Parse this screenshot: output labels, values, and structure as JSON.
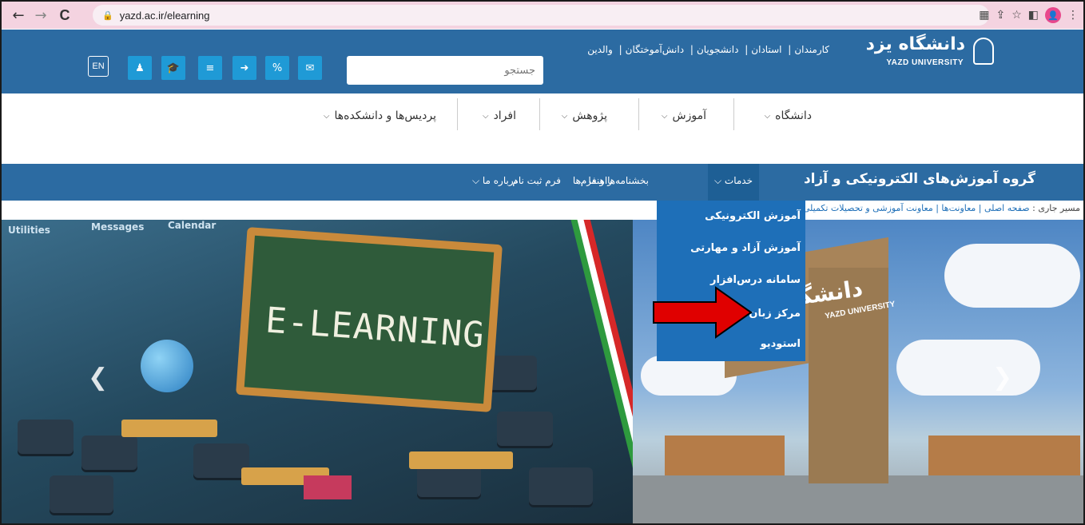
{
  "browser": {
    "url": "yazd.ac.ir/elearning",
    "back_icon": "←",
    "forward_icon": "→",
    "reload_icon": "C",
    "profile_initial": "●"
  },
  "header": {
    "logo_fa": "دانشگاه یزد",
    "logo_en": "YAZD UNIVERSITY",
    "top_links": [
      "کارمندان",
      "استادان",
      "دانشجویان",
      "دانش‌آموختگان",
      "والدین"
    ],
    "search_placeholder": "جستجو",
    "lang_button": "EN",
    "tool_icons": [
      "user-icon",
      "graduation-cap-icon",
      "database-icon",
      "sign-in-icon",
      "link-icon",
      "envelope-icon"
    ]
  },
  "main_nav": {
    "items": [
      {
        "label": "دانشگاه"
      },
      {
        "label": "آموزش"
      },
      {
        "label": "پژوهش"
      },
      {
        "label": "افراد"
      },
      {
        "label": "پردیس‌ها و دانشکده‌ها"
      }
    ]
  },
  "sub_nav": {
    "title": "گروه آموزش‌های الکترونیکی و آزاد",
    "items": [
      {
        "label": "خدمات"
      },
      {
        "label": "بخشنامه‌ها و فرم‌ها"
      },
      {
        "label": "راهنما"
      },
      {
        "label": "فرم ثبت نام"
      },
      {
        "label": "درباره ما"
      }
    ]
  },
  "breadcrumb": {
    "label": "مسیر جاری :",
    "path": "صفحه اصلی | معاونت‌ها | معاونت آموزشی و تحصیلات تکمیلی | گروه آموزش‌های الکترونیکی و آزاد"
  },
  "dropdown": {
    "items": [
      {
        "label": "آموزش الکترونیکی"
      },
      {
        "label": "آموزش آزاد و مهارتی"
      },
      {
        "label": "سامانه درس‌افزار"
      },
      {
        "label": "مرکز زبان"
      },
      {
        "label": "استودیو"
      }
    ]
  },
  "hero": {
    "board_text": "E-LEARNING",
    "gate_text_fa": "دانشگاه یزد",
    "gate_text_en": "YAZD UNIVERSITY",
    "app_labels": [
      "Utilities",
      "Messages",
      "Calendar"
    ]
  },
  "colors": {
    "header_blue": "#2c6ba2",
    "dropdown_blue": "#1e6fb8",
    "tool_button_blue": "#1f9ad6",
    "annotation_red": "#e00000"
  }
}
